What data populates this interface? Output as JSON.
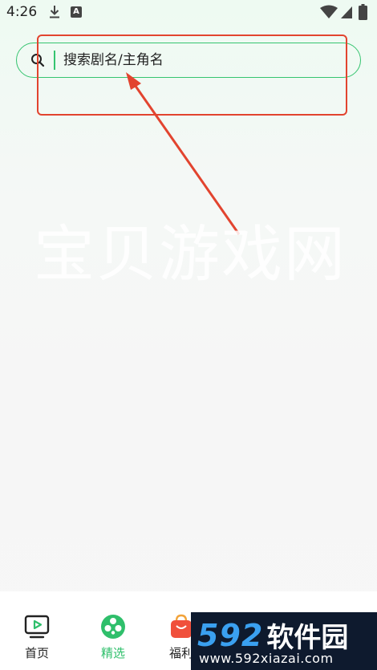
{
  "status_bar": {
    "time": "4:26",
    "icons": [
      "download-icon",
      "a-notification-icon",
      "wifi-icon",
      "signal-icon",
      "battery-icon"
    ]
  },
  "search": {
    "placeholder": "搜索剧名/主角名",
    "value": "",
    "accent_color": "#35c46f"
  },
  "annotation": {
    "color": "#e2442f"
  },
  "watermark": {
    "text": "宝贝游戏网"
  },
  "bottom_nav": {
    "active_color": "#2fbf6b",
    "items": [
      {
        "label": "首页",
        "icon": "tv-play-icon",
        "active": false
      },
      {
        "label": "精选",
        "icon": "film-reel-icon",
        "active": true
      },
      {
        "label": "福利",
        "icon": "gift-bag-icon",
        "active": false
      }
    ]
  },
  "site_logo": {
    "number": "592",
    "name": "软件园",
    "url": "www.592xiazai.com"
  }
}
